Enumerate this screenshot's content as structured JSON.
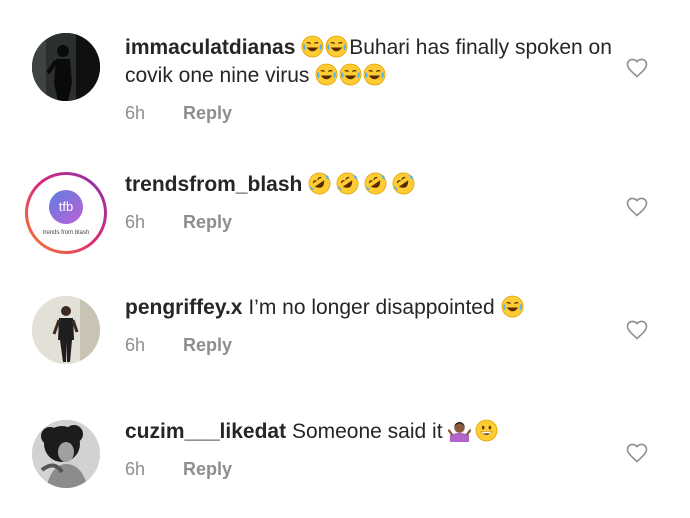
{
  "comments": [
    {
      "username": "immaculatdianas",
      "pre_text": "",
      "text_emojis_before": [
        "face-with-tears-of-joy-emoji",
        "face-with-tears-of-joy-emoji"
      ],
      "text": "Buhari has finally spoken on covik one nine virus",
      "text_emojis_after": [
        "face-with-tears-of-joy-emoji",
        "face-with-tears-of-joy-emoji",
        "face-with-tears-of-joy-emoji"
      ],
      "time": "6h",
      "reply_label": "Reply"
    },
    {
      "username": "trendsfrom_blash",
      "text": "",
      "text_emojis_after": [
        "rolling-on-floor-laughing-emoji",
        "rolling-on-floor-laughing-emoji",
        "rolling-on-floor-laughing-emoji",
        "rolling-on-floor-laughing-emoji"
      ],
      "avatar_label": "tfb",
      "avatar_caption": "trends from blash",
      "time": "6h",
      "reply_label": "Reply"
    },
    {
      "username": "pengriffey.x",
      "text": "I’m no longer disappointed",
      "text_emojis_after": [
        "face-with-tears-of-joy-emoji"
      ],
      "time": "6h",
      "reply_label": "Reply"
    },
    {
      "username": "cuzim___likedat",
      "text": "Someone said it",
      "text_emojis_after": [
        "person-shrugging-emoji",
        "grinning-face-emoji"
      ],
      "time": "6h",
      "reply_label": "Reply"
    }
  ],
  "icons": {
    "like": "heart-outline-icon"
  },
  "colors": {
    "text": "#262626",
    "meta": "#8e8e8e",
    "story_ring_start": "#f58529",
    "story_ring_end": "#8134af"
  }
}
